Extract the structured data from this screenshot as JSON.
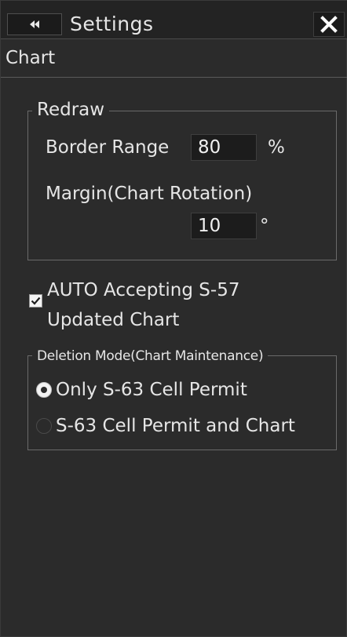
{
  "window": {
    "title": "Settings",
    "collapse_icon": "double-left-arrow-icon",
    "close_icon": "close-icon"
  },
  "section": {
    "title": "Chart"
  },
  "redraw": {
    "legend": "Redraw",
    "border_range_label": "Border Range",
    "border_range_value": "80",
    "border_range_unit": "%",
    "margin_label": "Margin(Chart Rotation)",
    "margin_value": "10",
    "margin_unit": "°"
  },
  "auto_accept": {
    "checked": true,
    "label_line1": "AUTO Accepting S-57",
    "label_line2": "Updated Chart"
  },
  "deletion_mode": {
    "legend": "Deletion Mode(Chart Maintenance)",
    "options": [
      {
        "label": "Only S-63 Cell Permit",
        "selected": true
      },
      {
        "label": "S-63 Cell Permit and Chart",
        "selected": false
      }
    ]
  }
}
